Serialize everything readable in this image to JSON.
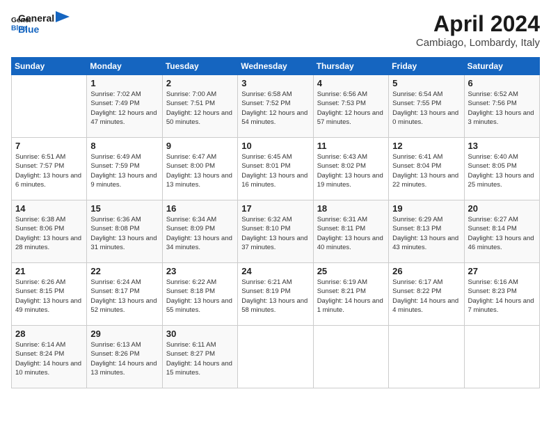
{
  "logo": {
    "line1": "General",
    "line2": "Blue"
  },
  "header": {
    "month_year": "April 2024",
    "location": "Cambiago, Lombardy, Italy"
  },
  "days_of_week": [
    "Sunday",
    "Monday",
    "Tuesday",
    "Wednesday",
    "Thursday",
    "Friday",
    "Saturday"
  ],
  "weeks": [
    [
      {
        "day": "",
        "detail": ""
      },
      {
        "day": "1",
        "detail": "Sunrise: 7:02 AM\nSunset: 7:49 PM\nDaylight: 12 hours\nand 47 minutes."
      },
      {
        "day": "2",
        "detail": "Sunrise: 7:00 AM\nSunset: 7:51 PM\nDaylight: 12 hours\nand 50 minutes."
      },
      {
        "day": "3",
        "detail": "Sunrise: 6:58 AM\nSunset: 7:52 PM\nDaylight: 12 hours\nand 54 minutes."
      },
      {
        "day": "4",
        "detail": "Sunrise: 6:56 AM\nSunset: 7:53 PM\nDaylight: 12 hours\nand 57 minutes."
      },
      {
        "day": "5",
        "detail": "Sunrise: 6:54 AM\nSunset: 7:55 PM\nDaylight: 13 hours\nand 0 minutes."
      },
      {
        "day": "6",
        "detail": "Sunrise: 6:52 AM\nSunset: 7:56 PM\nDaylight: 13 hours\nand 3 minutes."
      }
    ],
    [
      {
        "day": "7",
        "detail": "Sunrise: 6:51 AM\nSunset: 7:57 PM\nDaylight: 13 hours\nand 6 minutes."
      },
      {
        "day": "8",
        "detail": "Sunrise: 6:49 AM\nSunset: 7:59 PM\nDaylight: 13 hours\nand 9 minutes."
      },
      {
        "day": "9",
        "detail": "Sunrise: 6:47 AM\nSunset: 8:00 PM\nDaylight: 13 hours\nand 13 minutes."
      },
      {
        "day": "10",
        "detail": "Sunrise: 6:45 AM\nSunset: 8:01 PM\nDaylight: 13 hours\nand 16 minutes."
      },
      {
        "day": "11",
        "detail": "Sunrise: 6:43 AM\nSunset: 8:02 PM\nDaylight: 13 hours\nand 19 minutes."
      },
      {
        "day": "12",
        "detail": "Sunrise: 6:41 AM\nSunset: 8:04 PM\nDaylight: 13 hours\nand 22 minutes."
      },
      {
        "day": "13",
        "detail": "Sunrise: 6:40 AM\nSunset: 8:05 PM\nDaylight: 13 hours\nand 25 minutes."
      }
    ],
    [
      {
        "day": "14",
        "detail": "Sunrise: 6:38 AM\nSunset: 8:06 PM\nDaylight: 13 hours\nand 28 minutes."
      },
      {
        "day": "15",
        "detail": "Sunrise: 6:36 AM\nSunset: 8:08 PM\nDaylight: 13 hours\nand 31 minutes."
      },
      {
        "day": "16",
        "detail": "Sunrise: 6:34 AM\nSunset: 8:09 PM\nDaylight: 13 hours\nand 34 minutes."
      },
      {
        "day": "17",
        "detail": "Sunrise: 6:32 AM\nSunset: 8:10 PM\nDaylight: 13 hours\nand 37 minutes."
      },
      {
        "day": "18",
        "detail": "Sunrise: 6:31 AM\nSunset: 8:11 PM\nDaylight: 13 hours\nand 40 minutes."
      },
      {
        "day": "19",
        "detail": "Sunrise: 6:29 AM\nSunset: 8:13 PM\nDaylight: 13 hours\nand 43 minutes."
      },
      {
        "day": "20",
        "detail": "Sunrise: 6:27 AM\nSunset: 8:14 PM\nDaylight: 13 hours\nand 46 minutes."
      }
    ],
    [
      {
        "day": "21",
        "detail": "Sunrise: 6:26 AM\nSunset: 8:15 PM\nDaylight: 13 hours\nand 49 minutes."
      },
      {
        "day": "22",
        "detail": "Sunrise: 6:24 AM\nSunset: 8:17 PM\nDaylight: 13 hours\nand 52 minutes."
      },
      {
        "day": "23",
        "detail": "Sunrise: 6:22 AM\nSunset: 8:18 PM\nDaylight: 13 hours\nand 55 minutes."
      },
      {
        "day": "24",
        "detail": "Sunrise: 6:21 AM\nSunset: 8:19 PM\nDaylight: 13 hours\nand 58 minutes."
      },
      {
        "day": "25",
        "detail": "Sunrise: 6:19 AM\nSunset: 8:21 PM\nDaylight: 14 hours\nand 1 minute."
      },
      {
        "day": "26",
        "detail": "Sunrise: 6:17 AM\nSunset: 8:22 PM\nDaylight: 14 hours\nand 4 minutes."
      },
      {
        "day": "27",
        "detail": "Sunrise: 6:16 AM\nSunset: 8:23 PM\nDaylight: 14 hours\nand 7 minutes."
      }
    ],
    [
      {
        "day": "28",
        "detail": "Sunrise: 6:14 AM\nSunset: 8:24 PM\nDaylight: 14 hours\nand 10 minutes."
      },
      {
        "day": "29",
        "detail": "Sunrise: 6:13 AM\nSunset: 8:26 PM\nDaylight: 14 hours\nand 13 minutes."
      },
      {
        "day": "30",
        "detail": "Sunrise: 6:11 AM\nSunset: 8:27 PM\nDaylight: 14 hours\nand 15 minutes."
      },
      {
        "day": "",
        "detail": ""
      },
      {
        "day": "",
        "detail": ""
      },
      {
        "day": "",
        "detail": ""
      },
      {
        "day": "",
        "detail": ""
      }
    ]
  ]
}
